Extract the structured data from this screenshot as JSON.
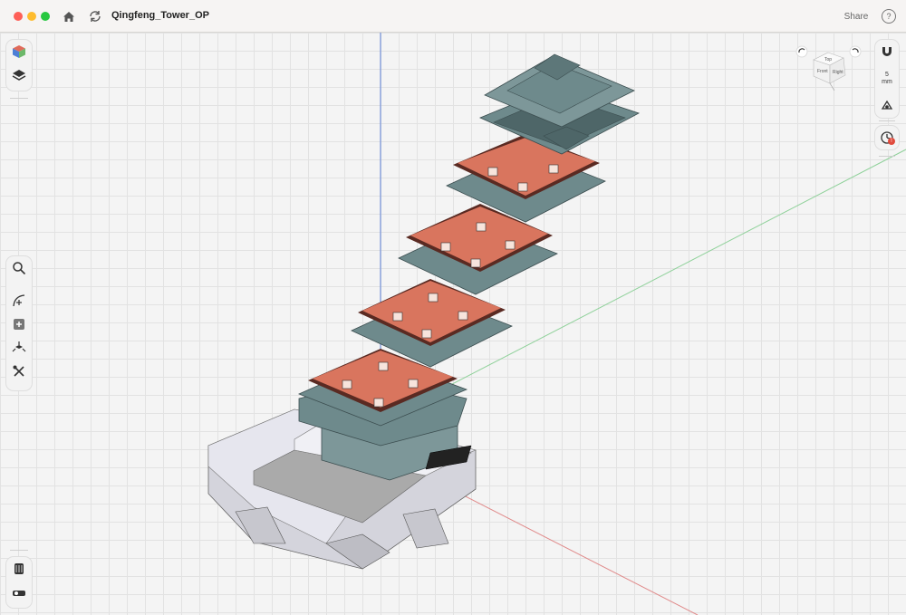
{
  "window": {
    "title": "Qingfeng_Tower_OP",
    "share_label": "Share",
    "help_label": "?"
  },
  "titlebar_icons": [
    "home-icon",
    "refresh-icon"
  ],
  "left_toolbar_top": [
    "cube-icon",
    "layers-icon"
  ],
  "left_toolbar_mid": [
    "search-icon",
    "sketch-curve-icon",
    "add-box-icon",
    "transform-icon",
    "tools-icon"
  ],
  "left_toolbar_bottom": [
    "materials-icon",
    "measure-icon"
  ],
  "right_toolbar": {
    "units_value": "5",
    "units_unit": "mm",
    "icons": [
      "magnet-icon",
      "snap-icon",
      "history-icon"
    ],
    "history_badge": "!"
  },
  "view_cube": {
    "top": "Top",
    "front": "Front",
    "right": "Right"
  },
  "colors": {
    "floor_slab": "#d9755e",
    "floor_slab_light": "#e07f66",
    "roof": "#6e8a8c",
    "roof_dark": "#4e6668",
    "railing": "#5a2a22",
    "platform": "#e2e2e8",
    "axis_blue": "#5b7fd6",
    "axis_green": "#8fd19a",
    "axis_red": "#e08a8a"
  }
}
